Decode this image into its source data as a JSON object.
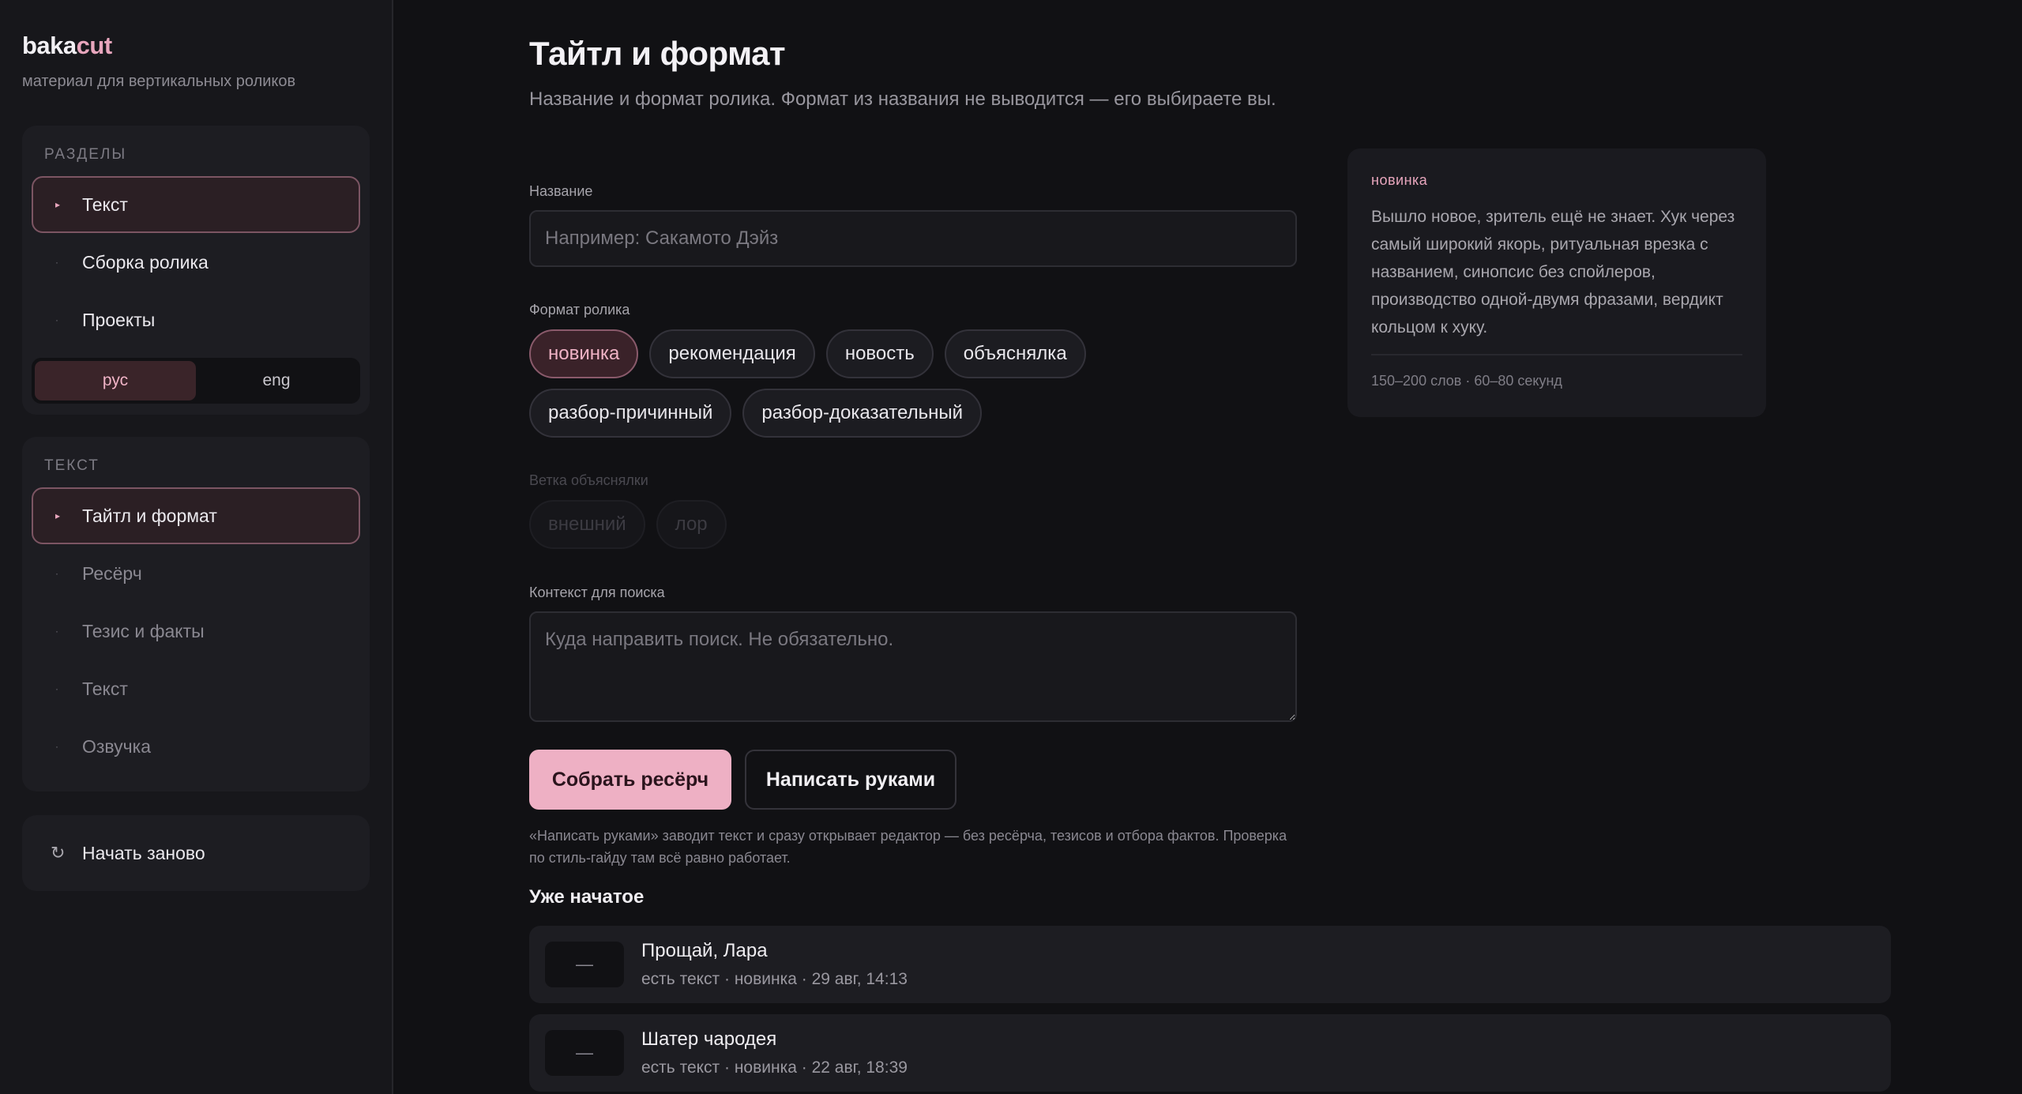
{
  "sidebar": {
    "logo_main": "baka",
    "logo_accent": "cut",
    "tagline": "материал для вертикальных роликов",
    "sections_title": "РАЗДЕЛЫ",
    "sections": [
      {
        "label": "Текст",
        "active": true
      },
      {
        "label": "Сборка ролика"
      },
      {
        "label": "Проекты"
      }
    ],
    "languages": [
      {
        "label": "рус",
        "active": true
      },
      {
        "label": "eng"
      }
    ],
    "text_title": "ТЕКСТ",
    "text_steps": [
      {
        "label": "Тайтл и формат",
        "active": true
      },
      {
        "label": "Ресёрч"
      },
      {
        "label": "Тезис и факты"
      },
      {
        "label": "Текст"
      },
      {
        "label": "Озвучка"
      }
    ],
    "restart_label": "Начать заново",
    "restart_icon": "refresh-icon"
  },
  "main": {
    "title": "Тайтл и формат",
    "subtitle": "Название и формат ролика. Формат из названия не выводится — его выбираете вы.",
    "name_label": "Название",
    "name_placeholder": "Например: Сакамото Дэйз",
    "format_label": "Формат ролика",
    "formats": [
      {
        "label": "новинка",
        "active": true
      },
      {
        "label": "рекомендация"
      },
      {
        "label": "новость"
      },
      {
        "label": "объяснялка"
      },
      {
        "label": "разбор-причинный"
      },
      {
        "label": "разбор-доказательный"
      }
    ],
    "branch_label": "Ветка объяснялки",
    "branches": [
      {
        "label": "внешний"
      },
      {
        "label": "лор"
      }
    ],
    "context_label": "Контекст для поиска",
    "context_placeholder": "Куда направить поиск. Не обязательно.",
    "primary_button": "Собрать ресёрч",
    "secondary_button": "Написать руками",
    "hint": "«Написать руками» заводит текст и сразу открывает редактор — без ресёрча, тезисов и отбора фактов. Проверка по стиль-гайду там всё равно работает.",
    "started_title": "Уже начатое",
    "projects": [
      {
        "thumb": "—",
        "title": "Прощай, Лара",
        "meta": "есть текст · новинка · 29 авг, 14:13"
      },
      {
        "thumb": "—",
        "title": "Шатер чародея",
        "meta": "есть текст · новинка · 22 авг, 18:39"
      }
    ]
  },
  "info_card": {
    "tag": "новинка",
    "description": "Вышло новое, зритель ещё не знает. Хук через самый широкий якорь, ритуальная врезка с названием, синопсис без спойлеров, производство одной-двумя фразами, вердикт кольцом к хуку.",
    "meta": "150–200 слов · 60–80 секунд"
  },
  "colors": {
    "accent": "#e8a6bd",
    "primary_button": "#eeb0c4",
    "background": "#111114",
    "sidebar": "#17171b"
  }
}
